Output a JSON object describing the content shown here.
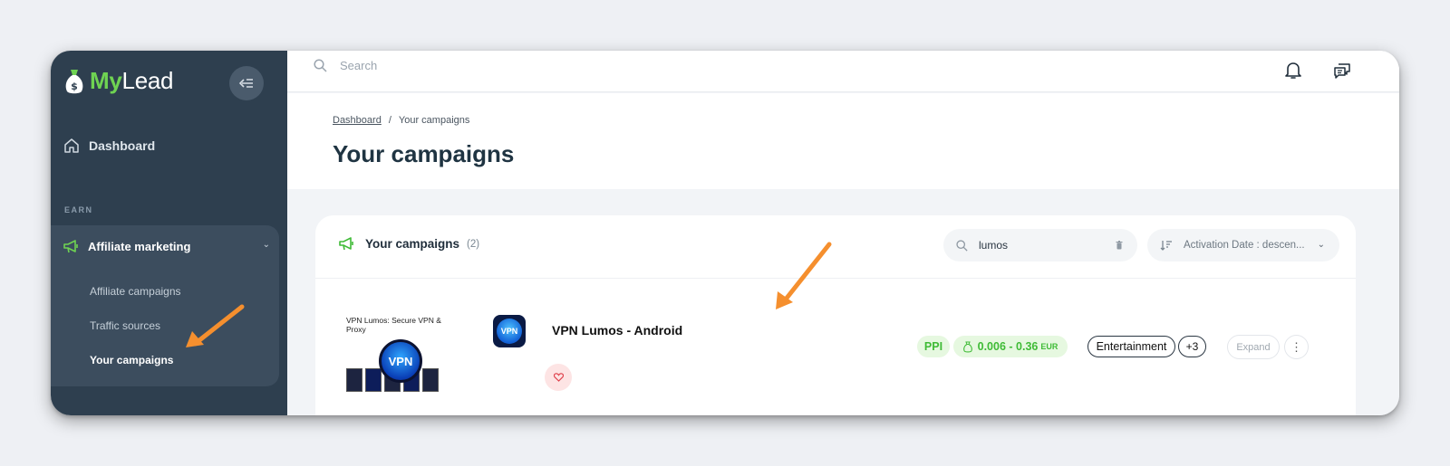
{
  "app": {
    "logo_prefix": "My",
    "logo_suffix": "Lead"
  },
  "sidebar": {
    "dashboard_label": "Dashboard",
    "section_label": "EARN",
    "group_label": "Affiliate marketing",
    "items": [
      {
        "label": "Affiliate campaigns",
        "active": false
      },
      {
        "label": "Traffic sources",
        "active": false
      },
      {
        "label": "Your campaigns",
        "active": true
      }
    ]
  },
  "topbar": {
    "search_placeholder": "Search"
  },
  "breadcrumb": {
    "home": "Dashboard",
    "separator": "/",
    "current": "Your campaigns"
  },
  "page_title": "Your campaigns",
  "card": {
    "title": "Your campaigns",
    "count": "(2)",
    "filter_value": "lumos",
    "sort_label": "Activation Date : descen..."
  },
  "campaign": {
    "thumb_caption": "VPN Lumos: Secure VPN & Proxy",
    "badge_text": "VPN",
    "app_icon_text": "VPN",
    "name": "VPN Lumos - Android",
    "type": "PPI",
    "payout": "0.006 - 0.36",
    "currency": "EUR",
    "category": "Entertainment",
    "more_categories": "+3",
    "expand_label": "Expand"
  },
  "colors": {
    "sidebar": "#2e3f4f",
    "accent_green": "#6fd352",
    "annotation_arrow": "#f58f2e"
  },
  "icons": [
    "money-bag-icon",
    "collapse-menu-icon",
    "home-icon",
    "megaphone-icon",
    "chevron-down-icon",
    "search-icon",
    "bell-icon",
    "chat-icon",
    "sort-icon",
    "clear-icon",
    "heart-icon",
    "moneybag-small-icon",
    "kebab-icon",
    "annotation-arrow"
  ]
}
